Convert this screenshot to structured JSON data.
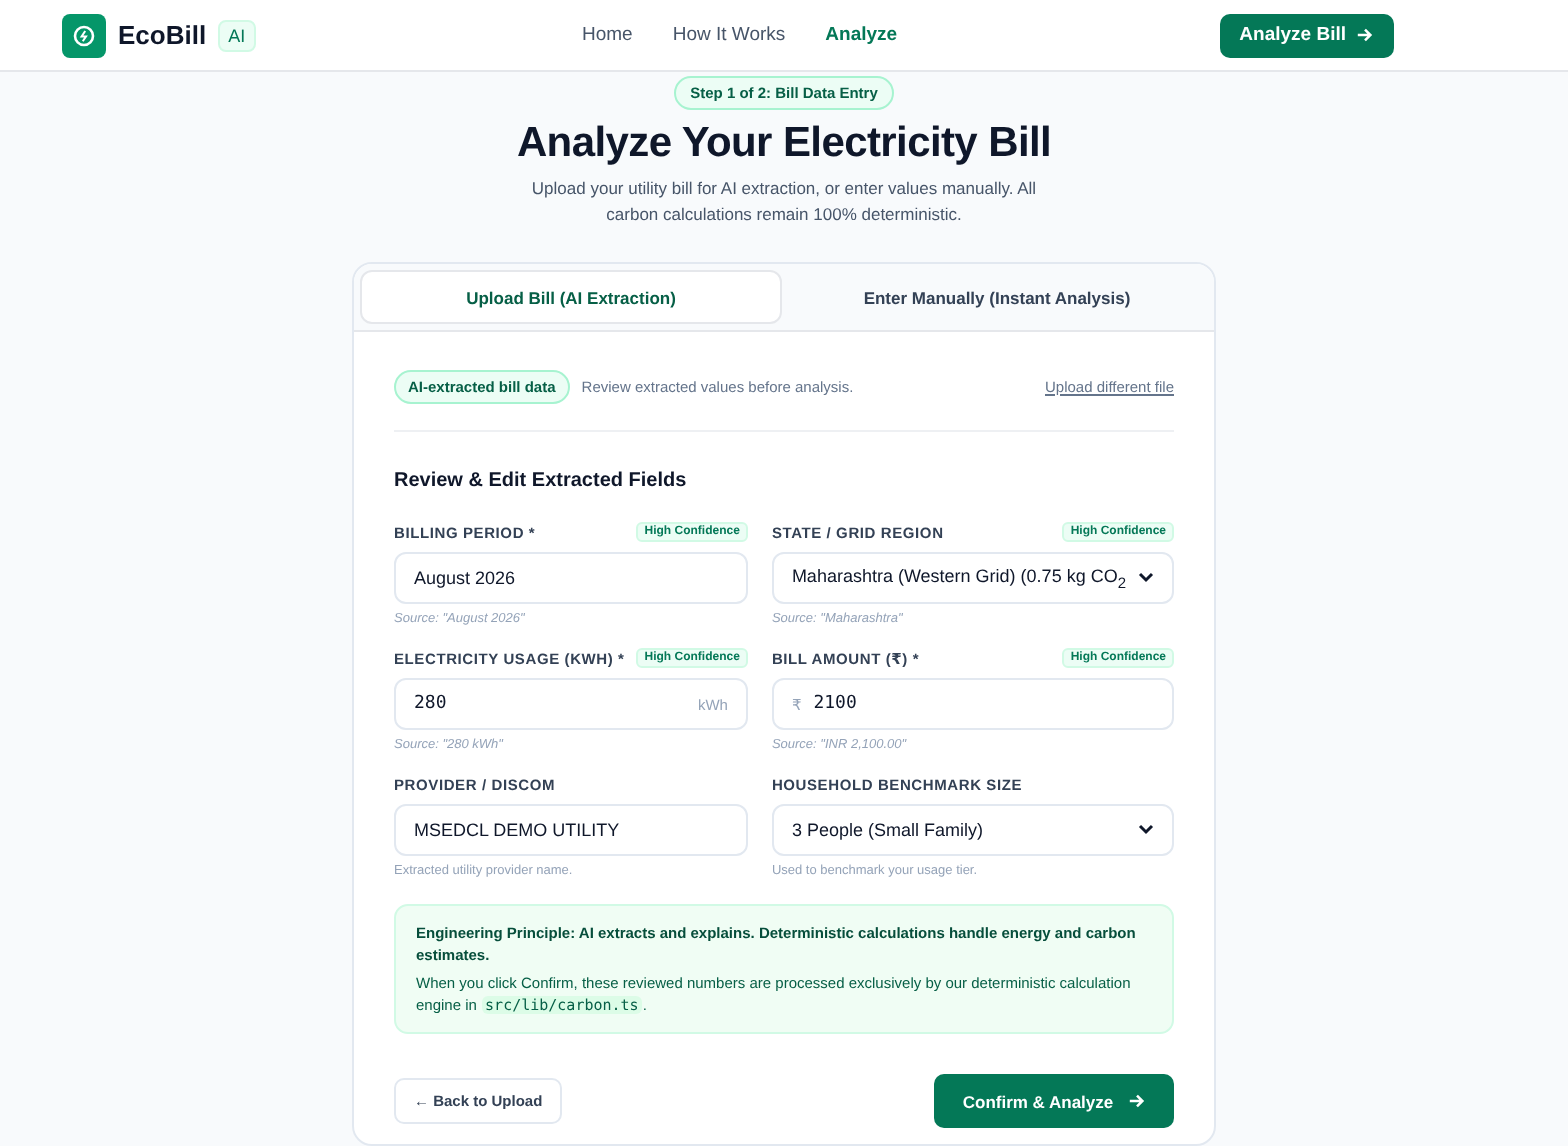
{
  "nav": {
    "brand": "EcoBill",
    "brand_badge": "AI",
    "links": [
      {
        "label": "Home",
        "selected": false
      },
      {
        "label": "How It Works",
        "selected": false
      },
      {
        "label": "Analyze",
        "selected": true
      }
    ],
    "cta": "Analyze Bill"
  },
  "hero": {
    "step": "Step 1 of 2: Bill Data Entry",
    "title": "Analyze Your Electricity Bill",
    "subtitle": "Upload your utility bill for AI extraction, or enter values manually. All carbon calculations remain 100% deterministic."
  },
  "tabs": [
    {
      "label": "Upload Bill (AI Extraction)",
      "selected": true
    },
    {
      "label": "Enter Manually (Instant Analysis)",
      "selected": false
    }
  ],
  "extract_bar": {
    "badge": "AI-extracted bill data",
    "note": "Review extracted values before analysis.",
    "link": "Upload different file"
  },
  "section_title": "Review & Edit Extracted Fields",
  "fields": [
    {
      "kind": "text",
      "label": "BILLING PERIOD *",
      "confidence": "High Confidence",
      "value": "August 2026",
      "hint": "Source: \"August 2026\"",
      "hint_italic": true
    },
    {
      "kind": "select",
      "label": "STATE / GRID REGION",
      "confidence": "High Confidence",
      "value": "Maharashtra (Western Grid) (0.75 kg CO$_{2}$",
      "hint": "Source: \"Maharashtra\"",
      "hint_italic": true
    },
    {
      "kind": "text",
      "label": "ELECTRICITY USAGE (KWH) *",
      "confidence": "High Confidence",
      "value": "280",
      "suffix": "kWh",
      "mono": true,
      "hint": "Source: \"280 kWh\"",
      "hint_italic": true
    },
    {
      "kind": "text",
      "label": "BILL AMOUNT (₹) *",
      "confidence": "High Confidence",
      "value": "2100",
      "prefix": "₹",
      "mono": true,
      "hint": "Source: \"INR 2,100.00\"",
      "hint_italic": true
    },
    {
      "kind": "text",
      "label": "PROVIDER / DISCOM",
      "value": "MSEDCL DEMO UTILITY",
      "hint": "Extracted utility provider name.",
      "hint_italic": false
    },
    {
      "kind": "select",
      "label": "HOUSEHOLD BENCHMARK SIZE",
      "value": "3 People (Small Family)",
      "hint": "Used to benchmark your usage tier.",
      "hint_italic": false
    }
  ],
  "notice": {
    "title": "Engineering Principle: AI extracts and explains. Deterministic calculations handle energy and carbon estimates.",
    "body_before": "When you click Confirm, these reviewed numbers are processed exclusively by our deterministic calculation engine in",
    "code": "src/lib/carbon.ts",
    "body_after": "."
  },
  "actions": {
    "back": "← Back to Upload",
    "confirm": "Confirm & Analyze"
  }
}
